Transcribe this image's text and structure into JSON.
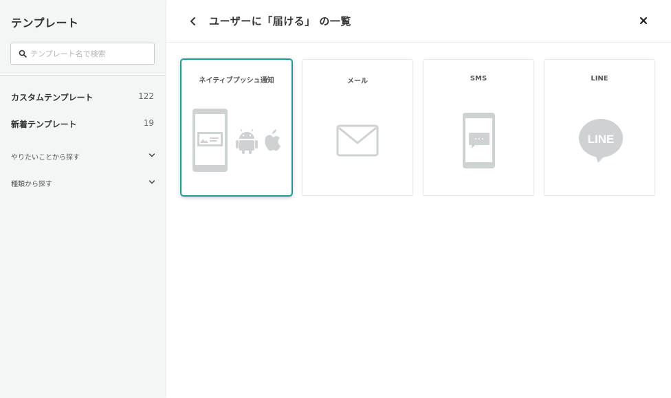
{
  "sidebar": {
    "title": "テンプレート",
    "search": {
      "placeholder": "テンプレート名で検索",
      "value": ""
    },
    "items": [
      {
        "label": "カスタムテンプレート",
        "count": "122"
      },
      {
        "label": "新着テンプレート",
        "count": "19"
      }
    ],
    "groups": [
      {
        "label": "やりたいことから探す"
      },
      {
        "label": "種類から探す"
      }
    ]
  },
  "header": {
    "title": "ユーザーに「届ける」 の一覧"
  },
  "cards": [
    {
      "label": "ネイティブプッシュ通知",
      "icon": "push-notification-icon",
      "selected": true
    },
    {
      "label": "メール",
      "icon": "mail-icon",
      "selected": false
    },
    {
      "label": "SMS",
      "icon": "sms-icon",
      "selected": false
    },
    {
      "label": "LINE",
      "icon": "line-icon",
      "icon_text": "LINE",
      "selected": false
    }
  ],
  "colors": {
    "accent": "#1a9a95",
    "icon_gray": "#cfd2d2",
    "sidebar_bg": "#f4f5f5"
  }
}
